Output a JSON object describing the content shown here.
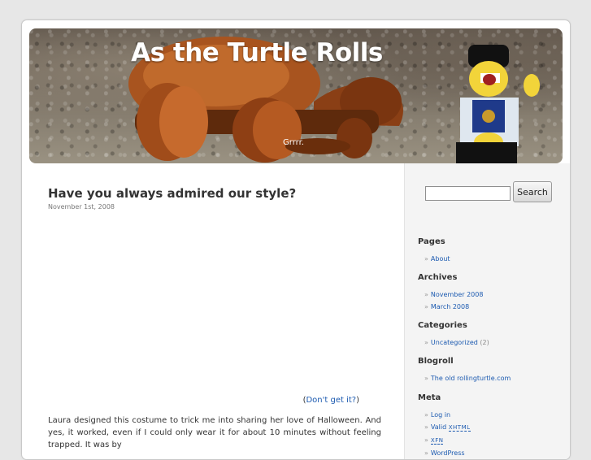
{
  "blog": {
    "title": "As the Turtle Rolls",
    "description": "Grrrr."
  },
  "post": {
    "title": "Have you always admired our style?",
    "date": "November 1st, 2008",
    "dont_get_prefix": "(",
    "dont_get_link": "Don't get it?",
    "dont_get_suffix": ")",
    "body": "Laura designed this costume to trick me into sharing her love of Halloween.  And yes, it worked, even if I could only wear it for about 10 minutes without feeling trapped.  It was by"
  },
  "search": {
    "placeholder": "",
    "button_label": "Search"
  },
  "sidebar": {
    "pages": {
      "heading": "Pages",
      "items": [
        {
          "label": "About"
        }
      ]
    },
    "archives": {
      "heading": "Archives",
      "items": [
        {
          "label": "November 2008"
        },
        {
          "label": "March 2008"
        }
      ]
    },
    "categories": {
      "heading": "Categories",
      "items": [
        {
          "label": "Uncategorized",
          "count": "(2)"
        }
      ]
    },
    "blogroll": {
      "heading": "Blogroll",
      "items": [
        {
          "label": "The old rollingturtle.com"
        }
      ]
    },
    "meta": {
      "heading": "Meta",
      "login": "Log in",
      "valid_prefix": "Valid ",
      "valid_abbr": "XHTML",
      "xfn": "XFN",
      "wordpress": "WordPress"
    },
    "bullet": "»"
  },
  "colors": {
    "link": "#1c5ab0",
    "text": "#333333",
    "sidebar_bg": "#f4f4f4",
    "page_bg": "#e7e7e7"
  },
  "icons": [
    "raquo-bullet-icon",
    "turtle-toy-illustration",
    "lego-figure-illustration"
  ]
}
